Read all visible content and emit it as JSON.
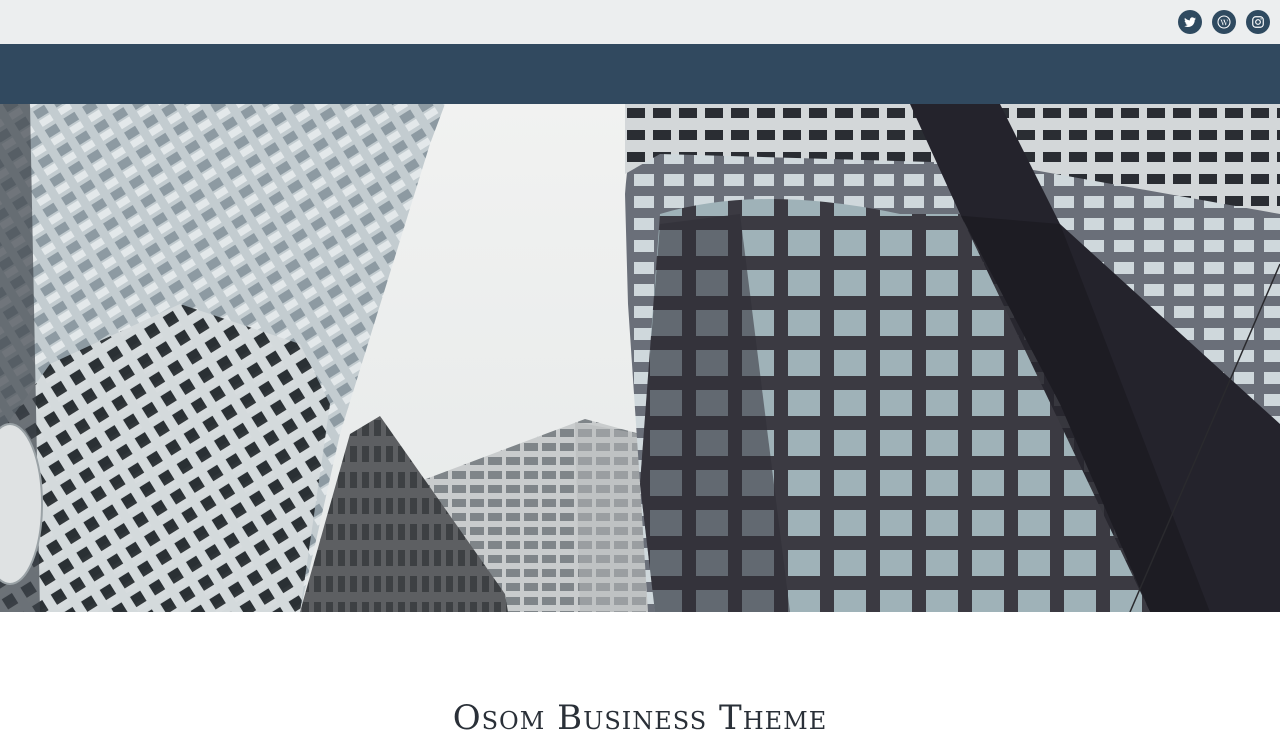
{
  "header": {
    "social": [
      {
        "icon": "twitter-icon",
        "label": "Twitter"
      },
      {
        "icon": "wordpress-icon",
        "label": "WordPress"
      },
      {
        "icon": "instagram-icon",
        "label": "Instagram"
      }
    ]
  },
  "hero": {
    "image": "city-skyscrapers-photo"
  },
  "main": {
    "title": "Osom Business Theme"
  },
  "colors": {
    "topbar": "#eceeef",
    "navbar": "#31495f",
    "social_icon_bg": "#2f4a60"
  }
}
